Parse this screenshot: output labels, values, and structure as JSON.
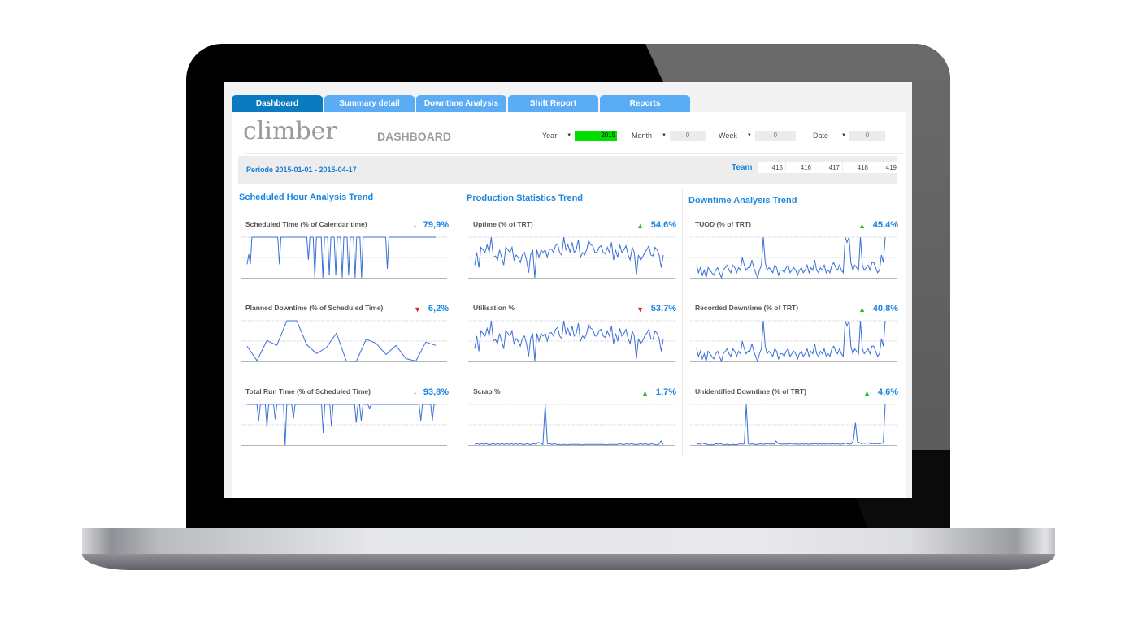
{
  "app": {
    "logo_text": "climber",
    "page_title": "DASHBOARD"
  },
  "tabs": [
    {
      "label": "Dashboard",
      "active": true
    },
    {
      "label": "Summary detail",
      "active": false
    },
    {
      "label": "Downtime Analysis",
      "active": false
    },
    {
      "label": "Shift Report",
      "active": false
    },
    {
      "label": "Reports",
      "active": false
    }
  ],
  "filters": {
    "year": {
      "label": "Year",
      "value": "2015",
      "highlight_color": "#00e000"
    },
    "month": {
      "label": "Month",
      "value": "0"
    },
    "week": {
      "label": "Week",
      "value": "0"
    },
    "date": {
      "label": "Date",
      "value": "0"
    }
  },
  "period": {
    "text": "Periode 2015-01-01 - 2015-04-17"
  },
  "team": {
    "label": "Team",
    "values": [
      "415",
      "416",
      "417",
      "418",
      "419"
    ]
  },
  "colors": {
    "accent": "#1a86e0",
    "tab_active": "#0a7bc0",
    "tab_inactive": "#5aacf5",
    "trend_up": "#2bbd2b",
    "trend_down": "#e02020",
    "line": "#3a6fd8"
  },
  "columns": [
    {
      "title": "Scheduled Hour Analysis Trend",
      "metrics": [
        {
          "label": "Scheduled Time (% of Calendar time)",
          "value": "79,9%",
          "trend": "flat",
          "trend_glyph": "-",
          "series": [
            40,
            62,
            40,
            100,
            100,
            100,
            100,
            100,
            100,
            100,
            100,
            100,
            100,
            100,
            100,
            100,
            100,
            100,
            100,
            100,
            40,
            100,
            100,
            100,
            100,
            100,
            100,
            100,
            100,
            100,
            100,
            100,
            100,
            100,
            100,
            100,
            100,
            100,
            50,
            100,
            100,
            100,
            10,
            100,
            100,
            100,
            100,
            10,
            100,
            100,
            100,
            15,
            100,
            100,
            100,
            15,
            100,
            100,
            100,
            10,
            100,
            100,
            100,
            15,
            100,
            100,
            100,
            10,
            100,
            100,
            100,
            10,
            100,
            100,
            100,
            100,
            100,
            100,
            100,
            100,
            100,
            100,
            100,
            100,
            100,
            100,
            100,
            30,
            100,
            100,
            100,
            100,
            100,
            100,
            100,
            100,
            100,
            100,
            100,
            100,
            100,
            100,
            100,
            100,
            100,
            100,
            100,
            100,
            100,
            100,
            100,
            100,
            100,
            100,
            100,
            100,
            100,
            100
          ]
        },
        {
          "label": "Planned Downtime (% of Scheduled Time)",
          "value": "6,2%",
          "trend": "down",
          "trend_glyph": "▼",
          "series": [
            38,
            3,
            52,
            40,
            100,
            100,
            42,
            20,
            35,
            70,
            2,
            1,
            55,
            45,
            18,
            40,
            8,
            2,
            48,
            40
          ]
        },
        {
          "label": "Total Run Time (% of Scheduled Time)",
          "value": "93,8%",
          "trend": "flat",
          "trend_glyph": "-",
          "series": [
            100,
            100,
            100,
            100,
            100,
            100,
            100,
            60,
            100,
            100,
            100,
            100,
            45,
            100,
            100,
            100,
            100,
            63,
            100,
            100,
            100,
            100,
            100,
            0,
            100,
            100,
            100,
            100,
            65,
            100,
            100,
            100,
            100,
            100,
            100,
            100,
            100,
            100,
            100,
            100,
            100,
            100,
            100,
            100,
            100,
            100,
            30,
            100,
            100,
            100,
            100,
            45,
            100,
            100,
            100,
            100,
            100,
            100,
            100,
            100,
            100,
            100,
            100,
            100,
            100,
            100,
            55,
            100,
            100,
            60,
            100,
            100,
            100,
            100,
            90,
            100,
            100,
            100,
            100,
            100,
            100,
            100,
            100,
            100,
            100,
            100,
            100,
            100,
            100,
            100,
            100,
            100,
            100,
            100,
            100,
            100,
            100,
            100,
            100,
            100,
            100,
            100,
            100,
            100,
            100,
            60,
            100,
            100,
            100,
            100,
            100,
            100,
            60,
            100,
            100
          ]
        }
      ]
    },
    {
      "title": "Production Statistics Trend",
      "metrics": [
        {
          "label": "Uptime (% of TRT)",
          "value": "54,6%",
          "trend": "up",
          "trend_glyph": "▲",
          "series": [
            30,
            55,
            25,
            65,
            60,
            55,
            70,
            55,
            85,
            45,
            48,
            40,
            60,
            45,
            30,
            65,
            60,
            55,
            65,
            40,
            50,
            45,
            35,
            50,
            55,
            40,
            15,
            50,
            60,
            5,
            60,
            45,
            60,
            55,
            60,
            45,
            60,
            62,
            55,
            68,
            72,
            55,
            50,
            85,
            60,
            70,
            55,
            75,
            55,
            60,
            80,
            45,
            55,
            50,
            60,
            78,
            70,
            68,
            55,
            55,
            65,
            68,
            55,
            52,
            65,
            55,
            75,
            40,
            60,
            45,
            70,
            55,
            60,
            68,
            50,
            40,
            65,
            55,
            10,
            50,
            40,
            45,
            55,
            60,
            68,
            50,
            48,
            65,
            60,
            50,
            25,
            50
          ]
        },
        {
          "label": "Utilisation %",
          "value": "53,7%",
          "trend": "down",
          "trend_glyph": "▼",
          "series": [
            30,
            55,
            25,
            65,
            60,
            55,
            70,
            55,
            85,
            45,
            48,
            40,
            60,
            45,
            30,
            65,
            60,
            55,
            65,
            40,
            50,
            45,
            35,
            50,
            55,
            40,
            15,
            50,
            60,
            5,
            60,
            45,
            60,
            55,
            60,
            45,
            60,
            62,
            55,
            68,
            72,
            55,
            50,
            85,
            60,
            70,
            55,
            75,
            55,
            60,
            80,
            45,
            55,
            50,
            60,
            78,
            70,
            68,
            55,
            55,
            65,
            68,
            55,
            52,
            65,
            55,
            75,
            40,
            60,
            45,
            70,
            55,
            60,
            68,
            50,
            40,
            65,
            55,
            10,
            50,
            40,
            45,
            55,
            60,
            68,
            50,
            48,
            65,
            60,
            50,
            25,
            50
          ]
        },
        {
          "label": "Scrap %",
          "value": "1,7%",
          "trend": "up",
          "trend_glyph": "▲",
          "series": [
            2,
            3,
            2,
            3,
            2,
            3,
            2,
            2,
            3,
            2,
            3,
            2,
            3,
            2,
            3,
            2,
            3,
            2,
            3,
            2,
            3,
            2,
            2,
            3,
            2,
            2,
            3,
            2,
            5,
            3,
            2,
            60,
            3,
            3,
            2,
            3,
            2,
            2,
            1,
            2,
            2,
            1,
            2,
            2,
            2,
            2,
            2,
            1,
            2,
            2,
            2,
            2,
            2,
            2,
            2,
            2,
            2,
            2,
            1,
            2,
            2,
            2,
            2,
            2,
            3,
            2,
            2,
            3,
            2,
            3,
            2,
            2,
            2,
            3,
            2,
            3,
            2,
            2,
            3,
            2,
            1,
            2,
            7,
            2
          ]
        }
      ]
    },
    {
      "title": "Downtime Analysis Trend",
      "metrics": [
        {
          "label": "TUOD (% of TRT)",
          "value": "45,4%",
          "trend": "up",
          "trend_glyph": "▲",
          "series": [
            45,
            30,
            40,
            25,
            35,
            20,
            40,
            35,
            30,
            25,
            35,
            40,
            30,
            20,
            35,
            40,
            45,
            35,
            30,
            45,
            40,
            30,
            40,
            35,
            60,
            45,
            35,
            40,
            40,
            55,
            40,
            30,
            20,
            35,
            45,
            100,
            50,
            35,
            40,
            35,
            30,
            45,
            40,
            25,
            35,
            35,
            30,
            40,
            45,
            30,
            35,
            40,
            35,
            25,
            35,
            40,
            30,
            35,
            45,
            30,
            40,
            35,
            55,
            35,
            30,
            40,
            35,
            45,
            30,
            35,
            30,
            45,
            50,
            40,
            35,
            45,
            35,
            30,
            100,
            90,
            100,
            50,
            35,
            45,
            40,
            35,
            100,
            45,
            35,
            40,
            45,
            35,
            50,
            50,
            40,
            30,
            35,
            65,
            50,
            100
          ]
        },
        {
          "label": "Recorded Downtime (% of TRT)",
          "value": "40,8%",
          "trend": "up",
          "trend_glyph": "▲",
          "series": [
            45,
            30,
            40,
            25,
            35,
            20,
            40,
            35,
            30,
            25,
            35,
            40,
            30,
            20,
            35,
            40,
            45,
            35,
            30,
            45,
            40,
            30,
            40,
            35,
            60,
            45,
            35,
            40,
            40,
            55,
            40,
            30,
            20,
            35,
            45,
            100,
            50,
            35,
            40,
            35,
            30,
            45,
            40,
            25,
            35,
            35,
            30,
            40,
            45,
            30,
            35,
            40,
            35,
            25,
            35,
            40,
            30,
            35,
            45,
            30,
            40,
            35,
            55,
            35,
            30,
            40,
            35,
            45,
            30,
            35,
            30,
            45,
            50,
            40,
            35,
            45,
            35,
            30,
            100,
            90,
            100,
            50,
            35,
            45,
            40,
            35,
            100,
            45,
            35,
            40,
            45,
            35,
            50,
            50,
            40,
            30,
            35,
            65,
            50,
            100
          ]
        },
        {
          "label": "Unidentified Downtime (% of TRT)",
          "value": "4,6%",
          "trend": "up",
          "trend_glyph": "▲",
          "series": [
            2,
            3,
            2,
            5,
            3,
            2,
            0,
            1,
            0,
            2,
            3,
            2,
            3,
            2,
            0,
            2,
            1,
            0,
            2,
            1,
            0,
            2,
            3,
            2,
            3,
            100,
            3,
            2,
            3,
            2,
            1,
            2,
            3,
            2,
            2,
            3,
            4,
            2,
            3,
            2,
            10,
            4,
            3,
            2,
            3,
            2,
            3,
            3,
            4,
            2,
            3,
            2,
            2,
            3,
            2,
            3,
            2,
            2,
            3,
            2,
            4,
            2,
            3,
            2,
            3,
            2,
            4,
            2,
            3,
            3,
            2,
            3,
            2,
            2,
            3,
            5,
            3,
            2,
            3,
            12,
            55,
            8,
            6,
            3,
            5,
            4,
            6,
            4,
            3,
            4,
            3,
            4,
            3,
            4,
            5,
            100
          ]
        }
      ]
    }
  ]
}
